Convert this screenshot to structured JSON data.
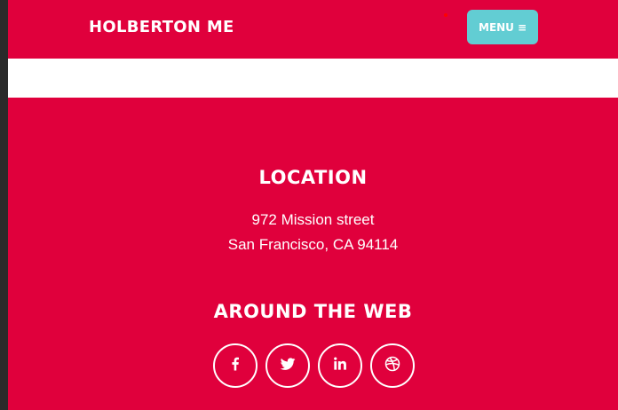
{
  "header": {
    "brand": "HOLBERTON ME",
    "menu_label": "MENU",
    "menu_icon": "hamburger-icon"
  },
  "location": {
    "heading": "LOCATION",
    "address_line1": "972 Mission street",
    "address_line2": "San Francisco, CA 94114"
  },
  "web": {
    "heading": "AROUND THE WEB",
    "links": [
      {
        "icon": "facebook-icon"
      },
      {
        "icon": "twitter-icon"
      },
      {
        "icon": "linkedin-icon"
      },
      {
        "icon": "dribbble-icon"
      }
    ]
  },
  "colors": {
    "brand_red": "#e0003c",
    "menu_button": "#62cdd3",
    "text": "#ffffff"
  }
}
